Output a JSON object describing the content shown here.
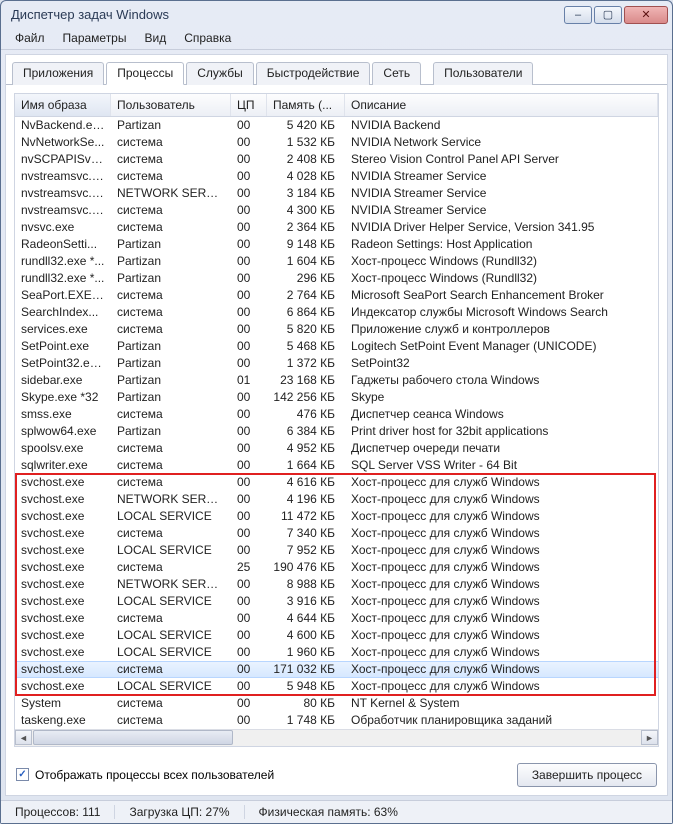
{
  "window": {
    "title": "Диспетчер задач Windows"
  },
  "win_controls": {
    "min": "–",
    "max": "▢",
    "close": "✕"
  },
  "menu": [
    "Файл",
    "Параметры",
    "Вид",
    "Справка"
  ],
  "tabs": [
    {
      "label": "Приложения"
    },
    {
      "label": "Процессы",
      "active": true
    },
    {
      "label": "Службы"
    },
    {
      "label": "Быстродействие"
    },
    {
      "label": "Сеть"
    },
    {
      "label": "Пользователи"
    }
  ],
  "columns": [
    {
      "label": "Имя образа",
      "sorted": true
    },
    {
      "label": "Пользователь"
    },
    {
      "label": "ЦП"
    },
    {
      "label": "Память (..."
    },
    {
      "label": "Описание"
    }
  ],
  "rows": [
    {
      "img": "NvBackend.ex...",
      "user": "Partizan",
      "cpu": "00",
      "mem": "5 420 КБ",
      "desc": "NVIDIA Backend"
    },
    {
      "img": "NvNetworkSe...",
      "user": "система",
      "cpu": "00",
      "mem": "1 532 КБ",
      "desc": "NVIDIA Network Service"
    },
    {
      "img": "nvSCPAPISvr.e...",
      "user": "система",
      "cpu": "00",
      "mem": "2 408 КБ",
      "desc": "Stereo Vision Control Panel API Server"
    },
    {
      "img": "nvstreamsvc.e...",
      "user": "система",
      "cpu": "00",
      "mem": "4 028 КБ",
      "desc": "NVIDIA Streamer Service"
    },
    {
      "img": "nvstreamsvc.e...",
      "user": "NETWORK SERVICE",
      "cpu": "00",
      "mem": "3 184 КБ",
      "desc": "NVIDIA Streamer Service"
    },
    {
      "img": "nvstreamsvc.e...",
      "user": "система",
      "cpu": "00",
      "mem": "4 300 КБ",
      "desc": "NVIDIA Streamer Service"
    },
    {
      "img": "nvsvc.exe",
      "user": "система",
      "cpu": "00",
      "mem": "2 364 КБ",
      "desc": "NVIDIA Driver Helper Service, Version 341.95"
    },
    {
      "img": "RadeonSetti...",
      "user": "Partizan",
      "cpu": "00",
      "mem": "9 148 КБ",
      "desc": "Radeon Settings: Host Application"
    },
    {
      "img": "rundll32.exe *...",
      "user": "Partizan",
      "cpu": "00",
      "mem": "1 604 КБ",
      "desc": "Хост-процесс Windows (Rundll32)"
    },
    {
      "img": "rundll32.exe *...",
      "user": "Partizan",
      "cpu": "00",
      "mem": "296 КБ",
      "desc": "Хост-процесс Windows (Rundll32)"
    },
    {
      "img": "SeaPort.EXE *32",
      "user": "система",
      "cpu": "00",
      "mem": "2 764 КБ",
      "desc": "Microsoft SeaPort Search Enhancement Broker"
    },
    {
      "img": "SearchIndex...",
      "user": "система",
      "cpu": "00",
      "mem": "6 864 КБ",
      "desc": "Индексатор службы Microsoft Windows Search"
    },
    {
      "img": "services.exe",
      "user": "система",
      "cpu": "00",
      "mem": "5 820 КБ",
      "desc": "Приложение служб и контроллеров"
    },
    {
      "img": "SetPoint.exe",
      "user": "Partizan",
      "cpu": "00",
      "mem": "5 468 КБ",
      "desc": "Logitech SetPoint Event Manager (UNICODE)"
    },
    {
      "img": "SetPoint32.ex...",
      "user": "Partizan",
      "cpu": "00",
      "mem": "1 372 КБ",
      "desc": "SetPoint32"
    },
    {
      "img": "sidebar.exe",
      "user": "Partizan",
      "cpu": "01",
      "mem": "23 168 КБ",
      "desc": "Гаджеты рабочего стола Windows"
    },
    {
      "img": "Skype.exe *32",
      "user": "Partizan",
      "cpu": "00",
      "mem": "142 256 КБ",
      "desc": "Skype"
    },
    {
      "img": "smss.exe",
      "user": "система",
      "cpu": "00",
      "mem": "476 КБ",
      "desc": "Диспетчер сеанса  Windows"
    },
    {
      "img": "splwow64.exe",
      "user": "Partizan",
      "cpu": "00",
      "mem": "6 384 КБ",
      "desc": "Print driver host for 32bit applications"
    },
    {
      "img": "spoolsv.exe",
      "user": "система",
      "cpu": "00",
      "mem": "4 952 КБ",
      "desc": "Диспетчер очереди печати"
    },
    {
      "img": "sqlwriter.exe",
      "user": "система",
      "cpu": "00",
      "mem": "1 664 КБ",
      "desc": "SQL Server VSS Writer - 64 Bit"
    },
    {
      "img": "svchost.exe",
      "user": "система",
      "cpu": "00",
      "mem": "4 616 КБ",
      "desc": "Хост-процесс для служб Windows",
      "hl": true
    },
    {
      "img": "svchost.exe",
      "user": "NETWORK SERVICE",
      "cpu": "00",
      "mem": "4 196 КБ",
      "desc": "Хост-процесс для служб Windows",
      "hl": true
    },
    {
      "img": "svchost.exe",
      "user": "LOCAL SERVICE",
      "cpu": "00",
      "mem": "11 472 КБ",
      "desc": "Хост-процесс для служб Windows",
      "hl": true
    },
    {
      "img": "svchost.exe",
      "user": "система",
      "cpu": "00",
      "mem": "7 340 КБ",
      "desc": "Хост-процесс для служб Windows",
      "hl": true
    },
    {
      "img": "svchost.exe",
      "user": "LOCAL SERVICE",
      "cpu": "00",
      "mem": "7 952 КБ",
      "desc": "Хост-процесс для служб Windows",
      "hl": true
    },
    {
      "img": "svchost.exe",
      "user": "система",
      "cpu": "25",
      "mem": "190 476 КБ",
      "desc": "Хост-процесс для служб Windows",
      "hl": true
    },
    {
      "img": "svchost.exe",
      "user": "NETWORK SERVICE",
      "cpu": "00",
      "mem": "8 988 КБ",
      "desc": "Хост-процесс для служб Windows",
      "hl": true
    },
    {
      "img": "svchost.exe",
      "user": "LOCAL SERVICE",
      "cpu": "00",
      "mem": "3 916 КБ",
      "desc": "Хост-процесс для служб Windows",
      "hl": true
    },
    {
      "img": "svchost.exe",
      "user": "система",
      "cpu": "00",
      "mem": "4 644 КБ",
      "desc": "Хост-процесс для служб Windows",
      "hl": true
    },
    {
      "img": "svchost.exe",
      "user": "LOCAL SERVICE",
      "cpu": "00",
      "mem": "4 600 КБ",
      "desc": "Хост-процесс для служб Windows",
      "hl": true
    },
    {
      "img": "svchost.exe",
      "user": "LOCAL SERVICE",
      "cpu": "00",
      "mem": "1 960 КБ",
      "desc": "Хост-процесс для служб Windows",
      "hl": true
    },
    {
      "img": "svchost.exe",
      "user": "система",
      "cpu": "00",
      "mem": "171 032 КБ",
      "desc": "Хост-процесс для служб Windows",
      "hl": true,
      "sel": true
    },
    {
      "img": "svchost.exe",
      "user": "LOCAL SERVICE",
      "cpu": "00",
      "mem": "5 948 КБ",
      "desc": "Хост-процесс для служб Windows",
      "hl": true
    },
    {
      "img": "System",
      "user": "система",
      "cpu": "00",
      "mem": "80 КБ",
      "desc": "NT Kernel & System"
    },
    {
      "img": "taskeng.exe",
      "user": "система",
      "cpu": "00",
      "mem": "1 748 КБ",
      "desc": "Обработчик планировщика заданий"
    }
  ],
  "highlight_range": {
    "start": 21,
    "end": 33
  },
  "checkbox_label": "Отображать процессы всех пользователей",
  "checkbox_checked": true,
  "end_button": "Завершить процесс",
  "status": {
    "procs": "Процессов: 111",
    "cpu": "Загрузка ЦП: 27%",
    "mem": "Физическая память: 63%"
  }
}
